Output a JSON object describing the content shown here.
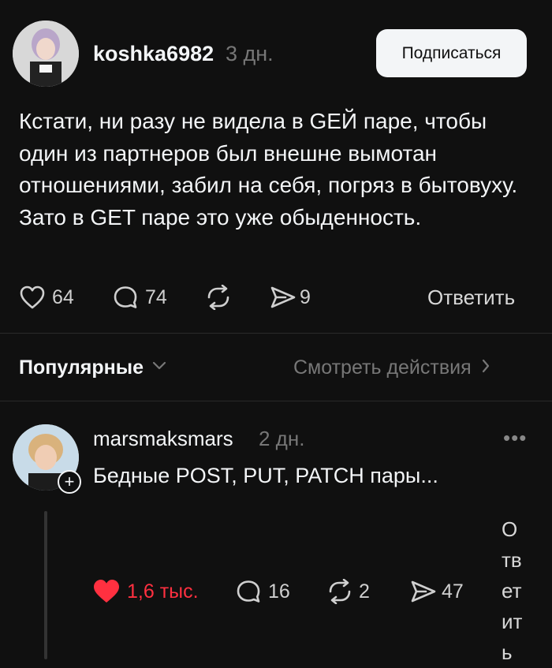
{
  "post": {
    "username": "koshka6982",
    "time": "3 дн.",
    "follow_label": "Подписаться",
    "text": "Кстати, ни разу не видела в GEЙ паре, чтобы один из партнеров был внешне вымотан отношениями, забил на себя, погряз в бытовуху. Зато в GET паре это уже обыденность.",
    "likes": "64",
    "comments": "74",
    "shares": "9",
    "reply_label": "Ответить"
  },
  "sort": {
    "label": "Популярные",
    "activity_label": "Смотреть действия"
  },
  "reply": {
    "username": "marsmaksmars",
    "time": "2 дн.",
    "text": "Бедные POST, PUT, PATCH пары...",
    "likes": "1,6 тыс.",
    "comments": "16",
    "reposts": "2",
    "shares": "47",
    "reply_label_lines": [
      "О",
      "тв",
      "ет",
      "ит",
      "ь"
    ]
  },
  "colors": {
    "background": "#101010",
    "text": "#f3f5f7",
    "muted": "#777777",
    "like_red": "#ff3040"
  }
}
